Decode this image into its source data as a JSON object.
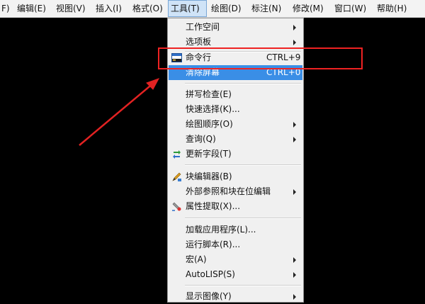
{
  "menubar": {
    "items": [
      {
        "label": "F)"
      },
      {
        "label": "编辑(E)"
      },
      {
        "label": "视图(V)"
      },
      {
        "label": "插入(I)"
      },
      {
        "label": "格式(O)"
      },
      {
        "label": "工具(T)"
      },
      {
        "label": "绘图(D)"
      },
      {
        "label": "标注(N)"
      },
      {
        "label": "修改(M)"
      },
      {
        "label": "窗口(W)"
      },
      {
        "label": "帮助(H)"
      }
    ]
  },
  "menu": {
    "items": [
      {
        "label": "工作空间",
        "submenu": true
      },
      {
        "label": "选项板",
        "submenu": true
      },
      {
        "label": "命令行",
        "shortcut": "CTRL+9",
        "icon": "command-line-icon"
      },
      {
        "label": "清除屏幕",
        "shortcut": "CTRL+0",
        "highlighted": true
      },
      {
        "label": "拼写检查(E)"
      },
      {
        "label": "快速选择(K)..."
      },
      {
        "label": "绘图顺序(O)",
        "submenu": true
      },
      {
        "label": "查询(Q)",
        "submenu": true
      },
      {
        "label": "更新字段(T)",
        "icon": "update-field-icon"
      },
      {
        "label": "块编辑器(B)",
        "icon": "block-editor-icon"
      },
      {
        "label": "外部参照和块在位编辑",
        "submenu": true
      },
      {
        "label": "属性提取(X)...",
        "icon": "attribute-extract-icon"
      },
      {
        "label": "加载应用程序(L)..."
      },
      {
        "label": "运行脚本(R)..."
      },
      {
        "label": "宏(A)",
        "submenu": true
      },
      {
        "label": "AutoLISP(S)",
        "submenu": true
      },
      {
        "label": "显示图像(Y)",
        "submenu": true
      }
    ]
  },
  "colors": {
    "highlight": "#3a8ee6",
    "annotation_red": "#e22222",
    "canvas": "#000000"
  }
}
